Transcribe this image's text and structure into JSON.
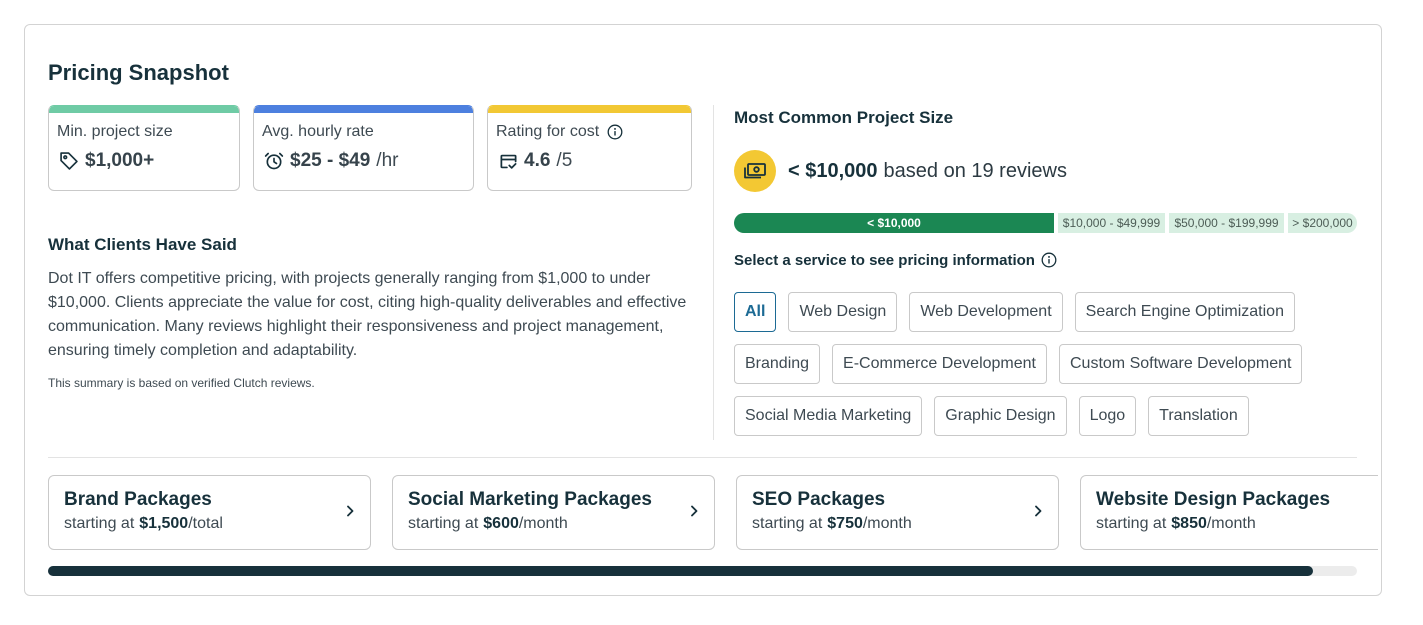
{
  "title": "Pricing Snapshot",
  "stats": [
    {
      "label": "Min. project size",
      "icon": "tag-icon",
      "value": "$1,000+",
      "accent": "#6fcba5"
    },
    {
      "label": "Avg. hourly rate",
      "icon": "alarm-clock-icon",
      "value": "$25 - $49",
      "suffix": "/hr",
      "accent": "#4d80df"
    },
    {
      "label": "Rating for cost",
      "icon": "card-check-icon",
      "info_icon": "info-icon",
      "value": "4.6",
      "suffix": "/5",
      "accent": "#f2c834"
    }
  ],
  "clients": {
    "heading": "What Clients Have Said",
    "summary": "Dot IT offers competitive pricing, with projects generally ranging from $1,000 to under $10,000. Clients appreciate the value for cost, citing high-quality deliverables and effective communication. Many reviews highlight their responsiveness and project management, ensuring timely completion and adaptability.",
    "note": "This summary is based on verified Clutch reviews."
  },
  "project_size": {
    "heading": "Most Common Project Size",
    "icon": "money-bill-icon",
    "icon_bg": "#f3c833",
    "most_common": "< $10,000",
    "reviews_text": "based on 19 reviews",
    "active_color": "#1b8753",
    "inactive_color": "#d8efe2",
    "ranges": [
      {
        "label": "< $10,000",
        "most_common": true
      },
      {
        "label": "$10,000 - $49,999",
        "most_common": false
      },
      {
        "label": "$50,000 - $199,999",
        "most_common": false
      },
      {
        "label": "> $200,000",
        "most_common": false
      }
    ]
  },
  "services": {
    "prompt": "Select a service to see pricing information",
    "info_icon": "info-icon",
    "selected_color": "#1c6a94",
    "items": [
      {
        "label": "All",
        "selected": true
      },
      {
        "label": "Web Design",
        "selected": false
      },
      {
        "label": "Web Development",
        "selected": false
      },
      {
        "label": "Search Engine Optimization",
        "selected": false
      },
      {
        "label": "Branding",
        "selected": false
      },
      {
        "label": "E-Commerce Development",
        "selected": false
      },
      {
        "label": "Custom Software Development",
        "selected": false
      },
      {
        "label": "Social Media Marketing",
        "selected": false
      },
      {
        "label": "Graphic Design",
        "selected": false
      },
      {
        "label": "Logo",
        "selected": false
      },
      {
        "label": "Translation",
        "selected": false
      }
    ]
  },
  "packages": [
    {
      "title": "Brand Packages",
      "prefix": "starting at",
      "price": "$1,500",
      "unit": "/total"
    },
    {
      "title": "Social Marketing Packages",
      "prefix": "starting at",
      "price": "$600",
      "unit": "/month"
    },
    {
      "title": "SEO Packages",
      "prefix": "starting at",
      "price": "$750",
      "unit": "/month"
    },
    {
      "title": "Website Design Packages",
      "prefix": "starting at",
      "price": "$850",
      "unit": "/month"
    }
  ],
  "package_icon": "chevron-right-icon"
}
